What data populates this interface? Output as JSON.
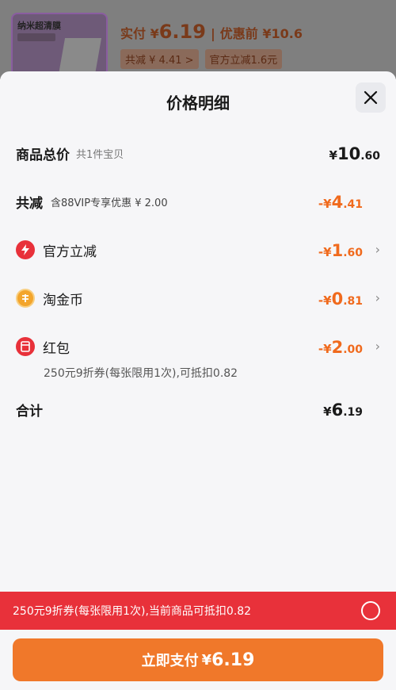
{
  "background": {
    "product_thumb_text": "纳米超清膜",
    "paid_label": "实付 ¥",
    "paid_value": "6.19",
    "original_label": "优惠前 ¥10.6",
    "tag_total_discount": "共减 ¥ 4.41 >",
    "tag_official": "官方立减1.6元"
  },
  "sheet": {
    "title": "价格明细",
    "total": {
      "label": "商品总价",
      "sub": "共1件宝贝",
      "yen": "¥",
      "int": "10",
      "dec": ".60"
    },
    "discount": {
      "label": "共减",
      "sub": "含88VIP专享优惠 ¥ 2.00",
      "yen": "-¥",
      "int": "4",
      "dec": ".41"
    },
    "items": [
      {
        "label": "官方立减",
        "icon": "lightning-icon",
        "yen": "-¥",
        "int": "1",
        "dec": ".60"
      },
      {
        "label": "淘金币",
        "icon": "coin-icon",
        "yen": "-¥",
        "int": "0",
        "dec": ".81"
      },
      {
        "label": "红包",
        "icon": "red-packet-icon",
        "yen": "-¥",
        "int": "2",
        "dec": ".00"
      }
    ],
    "coupon_note": "250元9折券(每张限用1次),可抵扣0.82",
    "sum": {
      "label": "合计",
      "yen": "¥",
      "int": "6",
      "dec": ".19"
    }
  },
  "coupon_bar": {
    "text": "250元9折券(每张限用1次),当前商品可抵扣0.82"
  },
  "pay_button": {
    "label": "立即支付",
    "yen": "¥",
    "amount": "6.19"
  },
  "colors": {
    "accent": "#f06a1d",
    "red": "#e8313a",
    "button": "#f0782a"
  }
}
